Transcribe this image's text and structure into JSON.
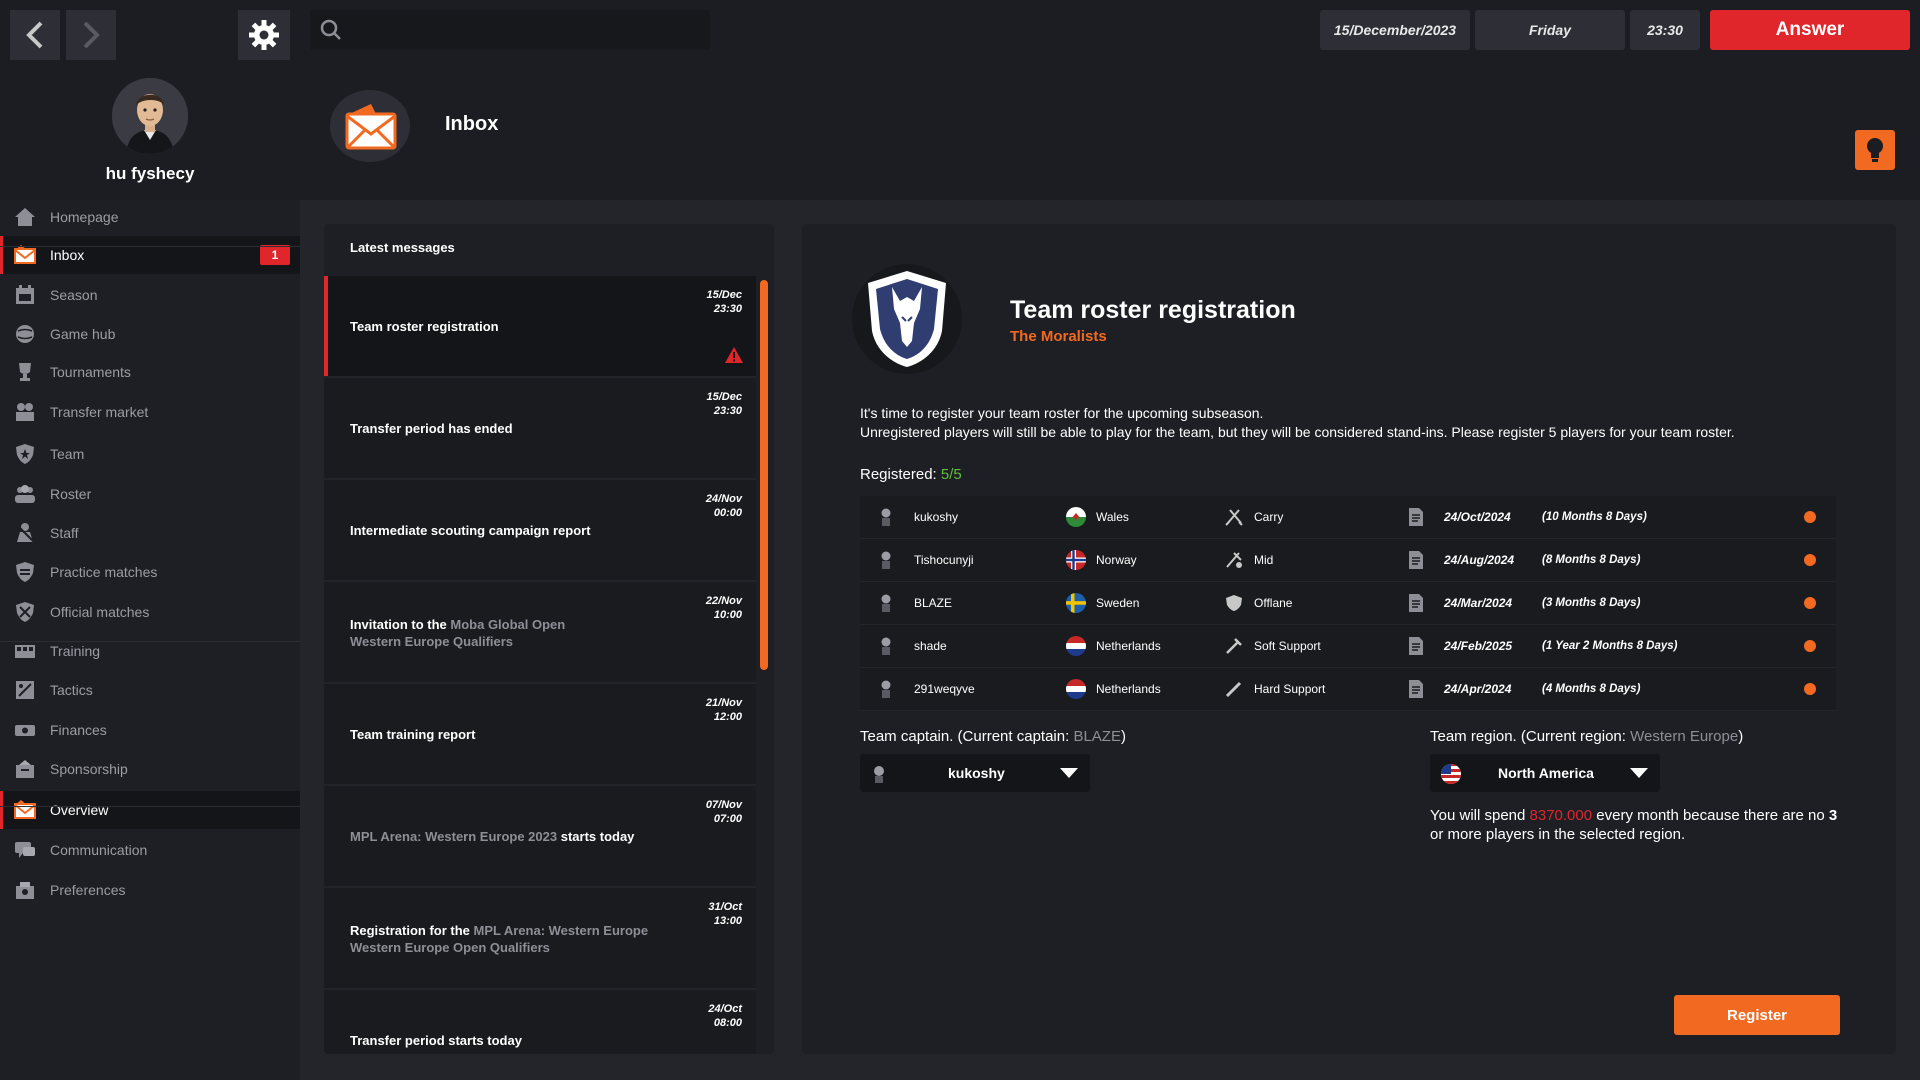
{
  "topbar": {
    "search_placeholder": "",
    "date": "15/December/2023",
    "weekday": "Friday",
    "time": "23:30",
    "answer_label": "Answer"
  },
  "user": {
    "name": "hu fyshecy"
  },
  "header": {
    "title": "Inbox"
  },
  "sidebar": {
    "items": [
      {
        "label": "Homepage",
        "icon": "home-icon"
      },
      {
        "label": "Inbox",
        "icon": "mail-icon",
        "badge": "1"
      },
      {
        "label": "Season",
        "icon": "calendar-icon"
      },
      {
        "label": "Game hub",
        "icon": "globe-icon"
      },
      {
        "label": "Tournaments",
        "icon": "trophy-icon"
      },
      {
        "label": "Transfer market",
        "icon": "transfer-icon"
      },
      {
        "label": "Team",
        "icon": "shield-icon"
      },
      {
        "label": "Roster",
        "icon": "people-icon"
      },
      {
        "label": "Staff",
        "icon": "staff-icon"
      },
      {
        "label": "Practice matches",
        "icon": "practice-icon"
      },
      {
        "label": "Official matches",
        "icon": "swords-icon"
      },
      {
        "label": "Training",
        "icon": "training-icon"
      },
      {
        "label": "Tactics",
        "icon": "tactics-icon"
      },
      {
        "label": "Finances",
        "icon": "money-icon"
      },
      {
        "label": "Sponsorship",
        "icon": "sponsor-icon"
      },
      {
        "label": "Overview",
        "icon": "mail-icon"
      },
      {
        "label": "Communication",
        "icon": "chat-icon"
      },
      {
        "label": "Preferences",
        "icon": "settings-icon"
      }
    ]
  },
  "messages": {
    "heading": "Latest messages",
    "items": [
      {
        "title": "Team roster registration",
        "date": "15/Dec",
        "time": "23:30"
      },
      {
        "title": "Transfer period has ended",
        "date": "15/Dec",
        "time": "23:30"
      },
      {
        "title": "Intermediate scouting campaign report",
        "date": "24/Nov",
        "time": "00:00"
      },
      {
        "prefix": "Invitation to the ",
        "highlight": "Moba Global Open",
        "sub": "Western Europe Qualifiers",
        "date": "22/Nov",
        "time": "10:00"
      },
      {
        "title": "Team training report",
        "date": "21/Nov",
        "time": "12:00"
      },
      {
        "highlight": "MPL Arena: Western Europe 2023",
        "suffix": " starts today",
        "date": "07/Nov",
        "time": "07:00"
      },
      {
        "prefix": "Registration for the ",
        "highlight": "MPL Arena: Western Europe",
        "sub": "Western Europe Open Qualifiers",
        "date": "31/Oct",
        "time": "13:00"
      },
      {
        "title": "Transfer period starts today",
        "date": "24/Oct",
        "time": "08:00"
      }
    ]
  },
  "detail": {
    "title": "Team roster registration",
    "team": "The Moralists",
    "line1": "It's time to register your team roster for the upcoming subseason.",
    "line2": "Unregistered players will still be able to play for the team, but they will be considered stand-ins. Please register 5 players for your team roster.",
    "registered_label": "Registered: ",
    "registered_value": "5/5",
    "roster": [
      {
        "name": "kukoshy",
        "country": "Wales",
        "role": "Carry",
        "date": "24/Oct/2024",
        "duration": "(10 Months 8 Days)"
      },
      {
        "name": "Tishocunyji",
        "country": "Norway",
        "role": "Mid",
        "date": "24/Aug/2024",
        "duration": "(8 Months 8 Days)"
      },
      {
        "name": "BLAZE",
        "country": "Sweden",
        "role": "Offlane",
        "date": "24/Mar/2024",
        "duration": "(3 Months 8 Days)"
      },
      {
        "name": "shade",
        "country": "Netherlands",
        "role": "Soft Support",
        "date": "24/Feb/2025",
        "duration": "(1 Year 2 Months 8 Days)"
      },
      {
        "name": "291weqyve",
        "country": "Netherlands",
        "role": "Hard Support",
        "date": "24/Apr/2024",
        "duration": "(4 Months 8 Days)"
      }
    ],
    "captain_label": "Team captain. (Current captain: ",
    "captain_current": "BLAZE",
    "captain_selected": "kukoshy",
    "region_label": "Team region. (Current region: ",
    "region_current": "Western Europe",
    "region_selected": "North America",
    "spend_prefix": "You will spend ",
    "spend_amount": "8370.000",
    "spend_suffix": " every month because there are no ",
    "spend_count": "3",
    "spend_end": " or more players in the selected region.",
    "register_label": "Register"
  },
  "colors": {
    "accent_orange": "#f26a21",
    "accent_red": "#e0262b",
    "success_green": "#5fbf3a"
  }
}
